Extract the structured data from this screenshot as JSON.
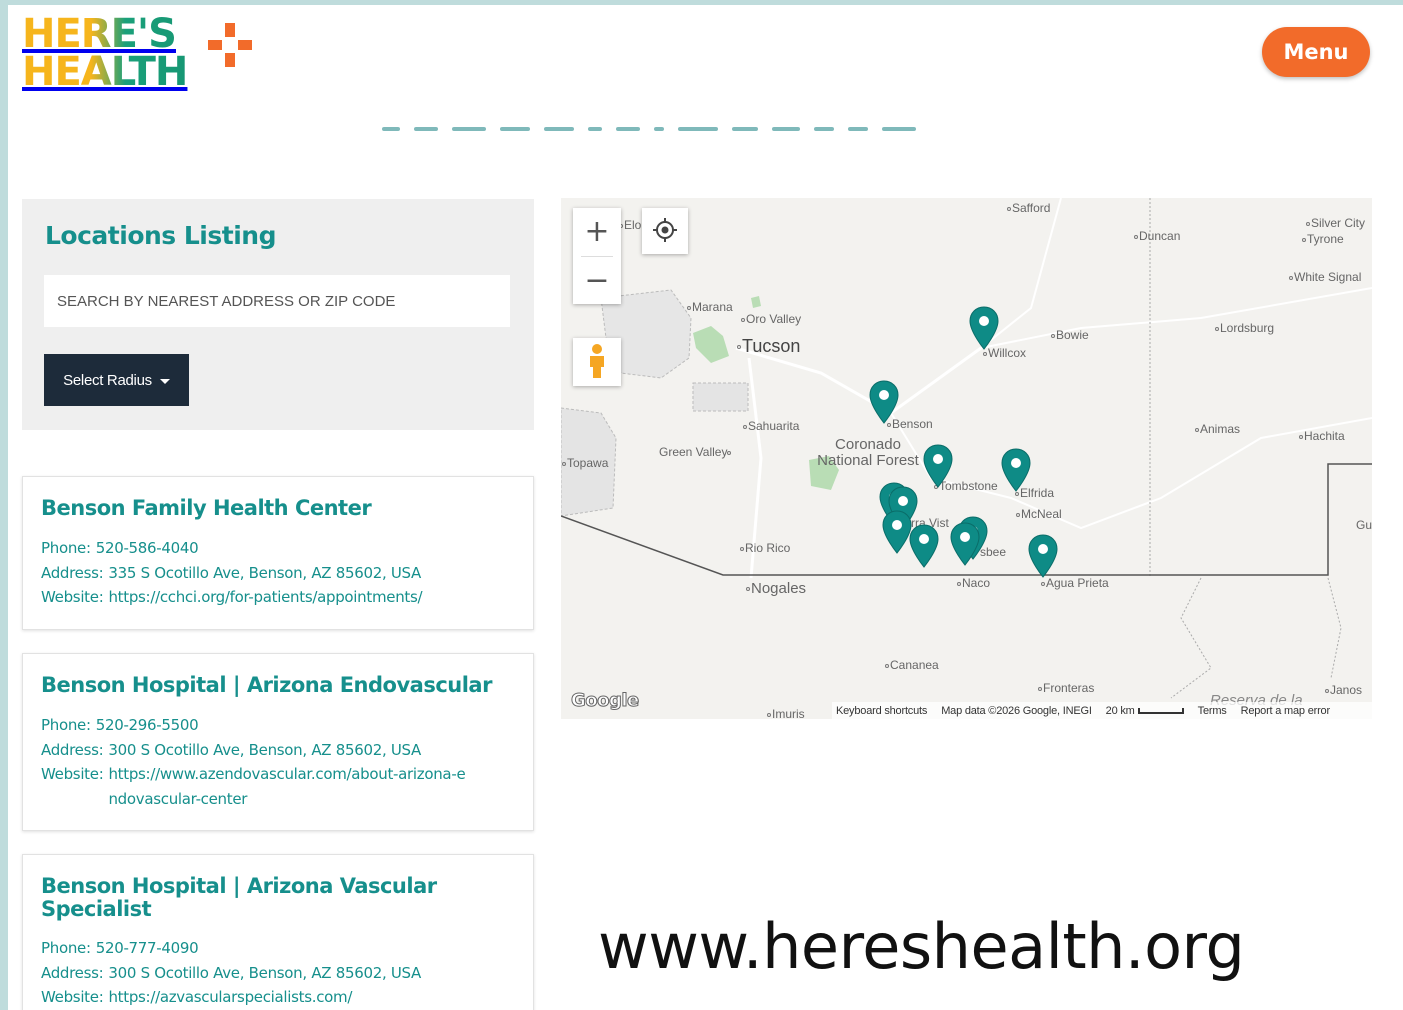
{
  "header": {
    "logo_line1": "HERE'S",
    "logo_line2": "HEALTH",
    "menu_label": "Menu"
  },
  "listing": {
    "title": "Locations Listing",
    "search_placeholder": "SEARCH BY NEAREST ADDRESS OR ZIP CODE",
    "radius_label": "Select Radius"
  },
  "locations": [
    {
      "name": "Benson Family Health Center",
      "phone_label": "Phone:",
      "phone": "520-586-4040",
      "address_label": "Address:",
      "address": "335 S Ocotillo Ave, Benson, AZ 85602, USA",
      "website_label": "Website:",
      "website": "https://cchci.org/for-patients/appointments/"
    },
    {
      "name": "Benson Hospital | Arizona Endovascular",
      "phone_label": "Phone:",
      "phone": "520-296-5500",
      "address_label": "Address:",
      "address": "300 S Ocotillo Ave, Benson, AZ 85602, USA",
      "website_label": "Website:",
      "website": "https://www.azendovascular.com/about-arizona-endovascular-center"
    },
    {
      "name": "Benson Hospital | Arizona Vascular Specialist",
      "phone_label": "Phone:",
      "phone": "520-777-4090",
      "address_label": "Address:",
      "address": "300 S Ocotillo Ave, Benson, AZ 85602, USA",
      "website_label": "Website:",
      "website": "https://azvascularspecialists.com/"
    }
  ],
  "map": {
    "labels": {
      "safford": "Safford",
      "duncan": "Duncan",
      "silver_city": "Silver City",
      "tyrone": "Tyrone",
      "white_signal": "White Signal",
      "elo": "Elo",
      "marana": "Marana",
      "oro_valley": "Oro Valley",
      "tucson": "Tucson",
      "bowie": "Bowie",
      "willcox": "Willcox",
      "lordsburg": "Lordsburg",
      "sahuarita": "Sahuarita",
      "benson": "Benson",
      "animas": "Animas",
      "hachita": "Hachita",
      "topawa": "Topawa",
      "green_valley": "Green Valley",
      "coronado": "Coronado National Forest",
      "tombstone": "Tombstone",
      "elfrida": "Elfrida",
      "mcneal": "McNeal",
      "sierra_vista": "rra Vist",
      "bisbee": "sbee",
      "rio_rico": "Rio Rico",
      "nogales": "Nogales",
      "naco": "Naco",
      "agua_prieta": "Agua Prieta",
      "cananea": "Cananea",
      "fronteras": "Fronteras",
      "imuris": "Imuris",
      "reserva": "Reserva de la",
      "janos": "Janos",
      "gu": "Gu"
    },
    "zoom_in": "+",
    "zoom_out": "−",
    "google": "Google",
    "attribution": {
      "shortcuts": "Keyboard shortcuts",
      "map_data": "Map data ©2026 Google, INEGI",
      "scale": "20 km",
      "terms": "Terms",
      "report": "Report a map error"
    }
  },
  "footer": {
    "url": "www.hereshealth.org"
  },
  "colors": {
    "brand_teal": "#168f8c",
    "brand_orange": "#f26b2a",
    "brand_yellow": "#f6b51c",
    "panel_dark": "#1d2b3a",
    "pin_teal": "#0e8b86"
  },
  "icons": [
    "plus-icon",
    "pin-marker-icon",
    "locate-icon",
    "pegman-icon",
    "chevron-down-icon"
  ]
}
